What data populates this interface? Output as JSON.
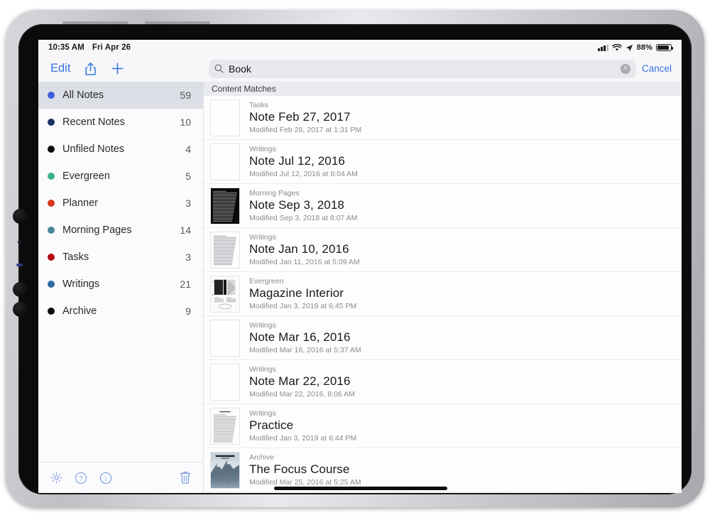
{
  "status_bar": {
    "time": "10:35 AM",
    "date": "Fri Apr 26",
    "battery_percent": "88%",
    "signal_icon": "cellular-bars-icon",
    "wifi_icon": "wifi-icon",
    "location_icon": "location-arrow-icon",
    "battery_icon": "battery-icon"
  },
  "toolbar": {
    "edit_label": "Edit",
    "share_icon": "share-icon",
    "add_icon": "plus-icon"
  },
  "search": {
    "value": "Book",
    "placeholder": "Search",
    "search_icon": "search-icon",
    "clear_icon": "clear-circle-icon",
    "cancel_label": "Cancel"
  },
  "sidebar": {
    "folders": [
      {
        "name": "All Notes",
        "count": "59",
        "color": "#3f5fe0",
        "selected": true
      },
      {
        "name": "Recent Notes",
        "count": "10",
        "color": "#1d3263",
        "selected": false
      },
      {
        "name": "Unfiled Notes",
        "count": "4",
        "color": "#0b0b0c",
        "selected": false
      },
      {
        "name": "Evergreen",
        "count": "5",
        "color": "#3cb184",
        "selected": false
      },
      {
        "name": "Planner",
        "count": "3",
        "color": "#d63a1c",
        "selected": false
      },
      {
        "name": "Morning Pages",
        "count": "14",
        "color": "#4b8699",
        "selected": false
      },
      {
        "name": "Tasks",
        "count": "3",
        "color": "#b30b14",
        "selected": false
      },
      {
        "name": "Writings",
        "count": "21",
        "color": "#2a6ba3",
        "selected": false
      },
      {
        "name": "Archive",
        "count": "9",
        "color": "#0b0b0c",
        "selected": false
      }
    ],
    "footer_icons": [
      "gear-icon",
      "help-circle-icon",
      "info-circle-icon",
      "trash-icon"
    ]
  },
  "results": {
    "section_header": "Content Matches",
    "rows": [
      {
        "folder": "Tasks",
        "title": "Note Feb 27, 2017",
        "meta": "Modified Feb 28, 2017 at 1:31 PM",
        "thumb": "blank"
      },
      {
        "folder": "Writings",
        "title": "Note Jul 12, 2016",
        "meta": "Modified Jul 12, 2016 at 8:04 AM",
        "thumb": "blank"
      },
      {
        "folder": "Morning Pages",
        "title": "Note Sep 3, 2018",
        "meta": "Modified Sep 3, 2018 at 8:07 AM",
        "thumb": "dark-handwriting"
      },
      {
        "folder": "Writings",
        "title": "Note Jan 10, 2016",
        "meta": "Modified Jan 11, 2016 at 5:09 AM",
        "thumb": "text-page"
      },
      {
        "folder": "Evergreen",
        "title": "Magazine Interior",
        "meta": "Modified Jan 3, 2019 at 6:45 PM",
        "thumb": "magazine"
      },
      {
        "folder": "Writings",
        "title": "Note Mar 16, 2016",
        "meta": "Modified Mar 16, 2016 at 5:37 AM",
        "thumb": "blank"
      },
      {
        "folder": "Writings",
        "title": "Note Mar 22, 2016",
        "meta": "Modified Mar 22, 2016, 8:06 AM",
        "thumb": "blank"
      },
      {
        "folder": "Writings",
        "title": "Practice",
        "meta": "Modified Jan 3, 2019 at 6:44 PM",
        "thumb": "titled-text-page"
      },
      {
        "folder": "Archive",
        "title": "The Focus Course",
        "meta": "Modified Mar 25, 2016 at 5:25 AM",
        "thumb": "mountain-lake"
      }
    ]
  },
  "colors": {
    "accent_blue": "#3575e0",
    "selected_row": "#dddfe6",
    "section_header_bg": "#e9ebf1"
  }
}
